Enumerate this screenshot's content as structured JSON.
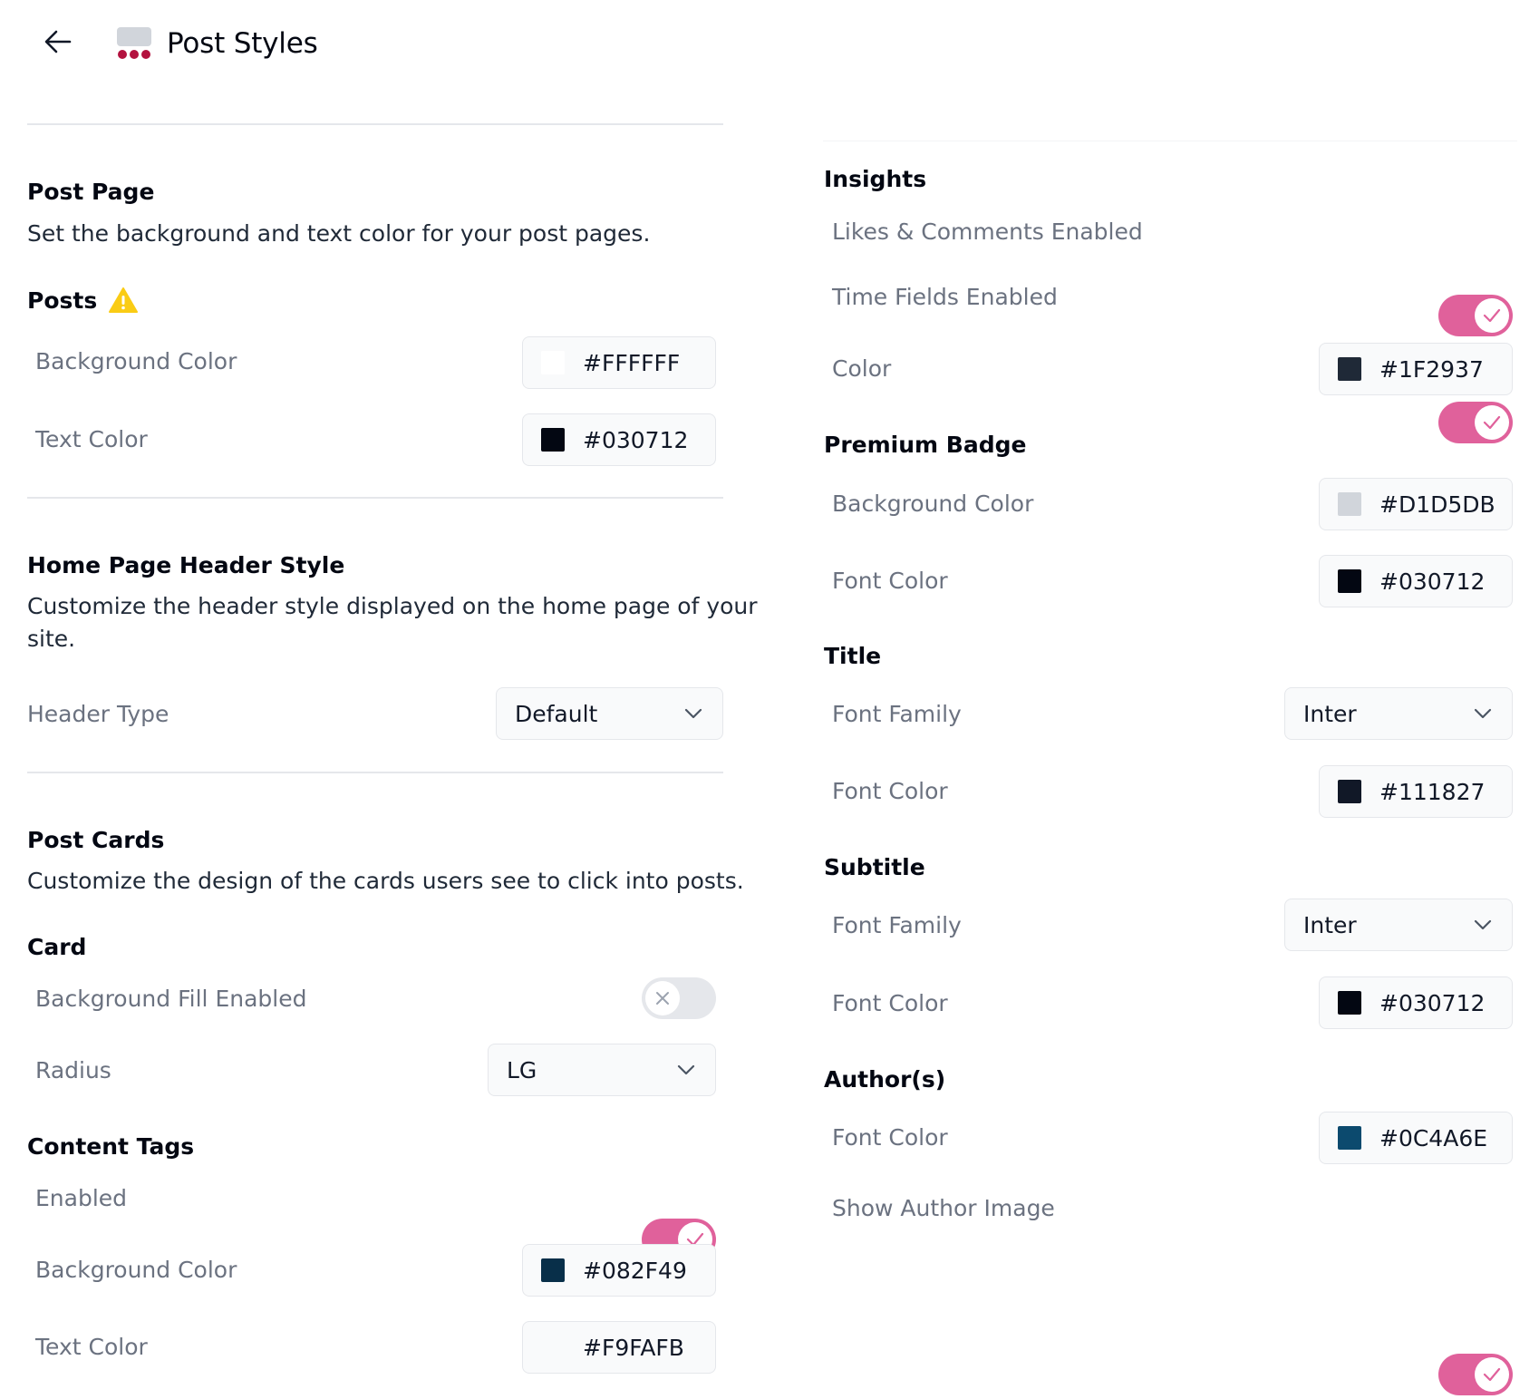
{
  "header": {
    "back_icon": "arrow-left-icon",
    "app_icon": "post-styles-icon",
    "title": "Post Styles"
  },
  "colors": {
    "accent": "#E0619B",
    "toggle_off": "#E5E7EB",
    "divider": "#E5E7EB",
    "label": "#6B7280"
  },
  "post_page": {
    "title": "Post Page",
    "description": "Set the background and text color for your post pages.",
    "posts": {
      "title": "Posts",
      "warning_icon": "warning-icon",
      "background_color": {
        "label": "Background Color",
        "value": "#FFFFFF"
      },
      "text_color": {
        "label": "Text Color",
        "value": "#030712"
      }
    }
  },
  "home_header": {
    "title": "Home Page Header Style",
    "description_line1": "Customize the header style displayed on the home page of your",
    "description_line2": "site.",
    "header_type": {
      "label": "Header Type",
      "value": "Default"
    }
  },
  "post_cards": {
    "title": "Post Cards",
    "description": "Customize the design of the cards users see to click into posts.",
    "card": {
      "title": "Card",
      "background_fill": {
        "label": "Background Fill Enabled",
        "enabled": false
      },
      "radius": {
        "label": "Radius",
        "value": "LG"
      }
    },
    "content_tags": {
      "title": "Content Tags",
      "enabled": {
        "label": "Enabled",
        "enabled": true
      },
      "background_color": {
        "label": "Background Color",
        "value": "#082F49"
      },
      "text_color": {
        "label": "Text Color",
        "value": "#F9FAFB"
      }
    },
    "insights": {
      "title": "Insights",
      "likes_comments": {
        "label": "Likes & Comments Enabled",
        "enabled": true
      },
      "time_fields": {
        "label": "Time Fields Enabled",
        "enabled": true
      },
      "color": {
        "label": "Color",
        "value": "#1F2937"
      }
    },
    "premium_badge": {
      "title": "Premium Badge",
      "background_color": {
        "label": "Background Color",
        "value": "#D1D5DB"
      },
      "font_color": {
        "label": "Font Color",
        "value": "#030712"
      }
    },
    "title_section": {
      "title": "Title",
      "font_family": {
        "label": "Font Family",
        "value": "Inter"
      },
      "font_color": {
        "label": "Font Color",
        "value": "#111827"
      }
    },
    "subtitle_section": {
      "title": "Subtitle",
      "font_family": {
        "label": "Font Family",
        "value": "Inter"
      },
      "font_color": {
        "label": "Font Color",
        "value": "#030712"
      }
    },
    "authors": {
      "title": "Author(s)",
      "font_color": {
        "label": "Font Color",
        "value": "#0C4A6E"
      },
      "show_image": {
        "label": "Show Author Image",
        "enabled": true
      }
    }
  }
}
